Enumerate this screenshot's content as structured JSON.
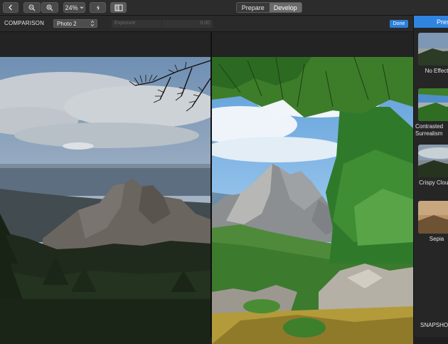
{
  "toolbar": {
    "zoom_label": "24%",
    "modes": [
      {
        "label": "Prepare",
        "active": false
      },
      {
        "label": "Develop",
        "active": true
      }
    ]
  },
  "comparison_bar": {
    "title": "COMPARISON",
    "photo_select_value": "Photo 2",
    "exposure_label": "Exposure",
    "exposure_value": "0,00",
    "done_label": "Done"
  },
  "panel": {
    "tab_label": "Presets",
    "presets": [
      {
        "label": "No Effect"
      },
      {
        "label": "Contrasted Surrealism"
      },
      {
        "label": "Crispy Clouds"
      },
      {
        "label": "Sepia"
      }
    ],
    "snapshots_label": "SNAPSHOTS"
  },
  "colors": {
    "accent": "#2f84e0",
    "done_button": "#2f7fd8",
    "toolbar_bg": "#2c2c2c",
    "canvas_bg": "#232323"
  }
}
